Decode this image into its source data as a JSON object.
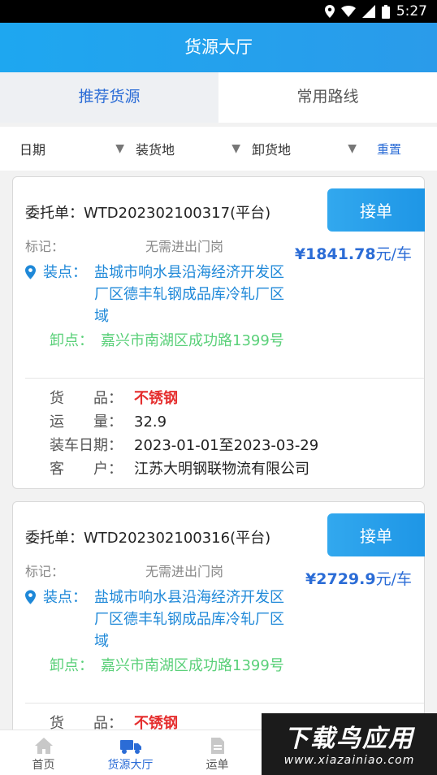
{
  "status_bar": {
    "time": "5:27"
  },
  "header": {
    "title": "货源大厅"
  },
  "tabs": [
    {
      "label": "推荐货源",
      "active": true
    },
    {
      "label": "常用路线",
      "active": false
    }
  ],
  "filters": {
    "date": "日期",
    "load_place": "装货地",
    "unload_place": "卸货地",
    "reset": "重置"
  },
  "labels": {
    "order_prefix": "委托单：",
    "remark": "标记：",
    "load": "装点：",
    "unload": "卸点：",
    "goods": "货　　品：",
    "volume": "运　　量：",
    "load_date": "装车日期：",
    "customer": "客　　户：",
    "accept": "接单",
    "price_unit": "元/车"
  },
  "orders": [
    {
      "order_no": "WTD202302100317(平台)",
      "remark": "无需进出门岗",
      "price": "¥1841.78",
      "load": "盐城市响水县沿海经济开发区厂区德丰轧钢成品库冷轧厂区域",
      "unload": "嘉兴市南湖区成功路1399号",
      "goods": "不锈钢",
      "volume": "32.9",
      "load_date": "2023-01-01至2023-03-29",
      "customer": "江苏大明钢联物流有限公司"
    },
    {
      "order_no": "WTD202302100316(平台)",
      "remark": "无需进出门岗",
      "price": "¥2729.9",
      "load": "盐城市响水县沿海经济开发区厂区德丰轧钢成品库冷轧厂区域",
      "unload": "嘉兴市南湖区成功路1399号",
      "goods": "不锈钢"
    }
  ],
  "bottom_nav": [
    {
      "label": "首页",
      "icon": "home-icon",
      "active": false
    },
    {
      "label": "货源大厅",
      "icon": "truck-icon",
      "active": true
    },
    {
      "label": "运单",
      "icon": "document-icon",
      "active": false
    }
  ],
  "watermark": {
    "title": "下载鸟应用",
    "url": "www.xiazainiao.com"
  },
  "colors": {
    "primary": "#2a9bea",
    "accent_blue": "#2b6cd6",
    "load_blue": "#1e88d8",
    "unload_green": "#5ad079",
    "goods_red": "#e52e2e"
  }
}
